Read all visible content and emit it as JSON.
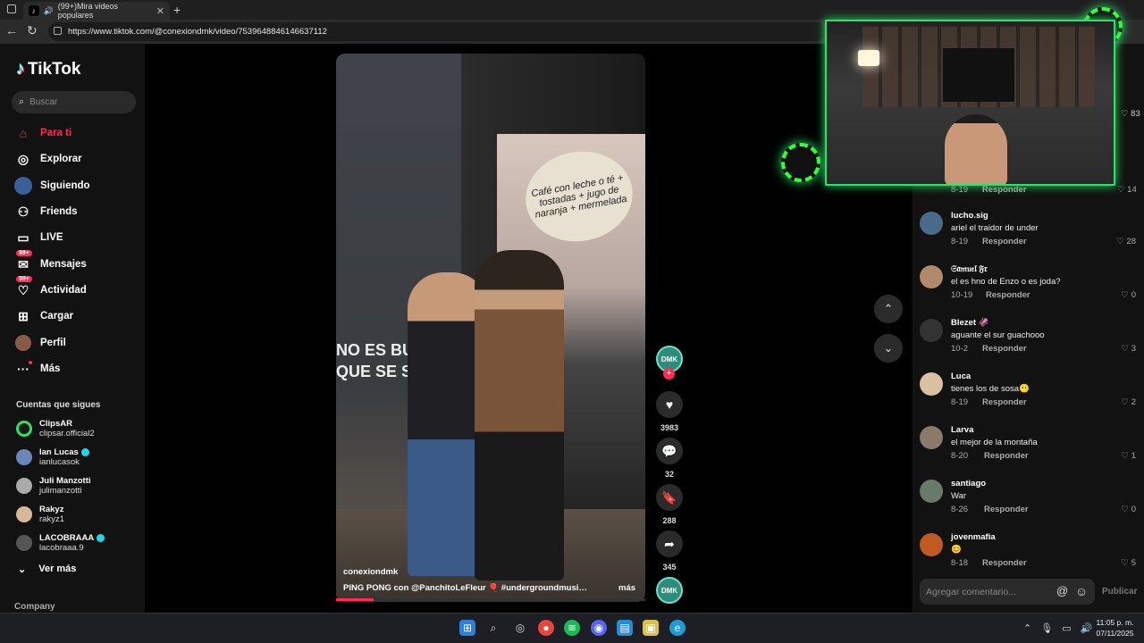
{
  "browser": {
    "tab_title": "(99+)Mira videos populares",
    "url": "https://www.tiktok.com/@conexiondmk/video/7539648846146637112"
  },
  "brand": {
    "name": "TikTok",
    "accent": "#fe2c55"
  },
  "search": {
    "placeholder": "Buscar"
  },
  "nav": [
    {
      "label": "Para ti",
      "icon": "home-icon",
      "active": true
    },
    {
      "label": "Explorar",
      "icon": "compass-icon"
    },
    {
      "label": "Siguiendo",
      "icon": "following-avatar-icon"
    },
    {
      "label": "Friends",
      "icon": "friends-icon"
    },
    {
      "label": "LIVE",
      "icon": "live-icon"
    },
    {
      "label": "Mensajes",
      "icon": "messages-icon",
      "badge": "99+"
    },
    {
      "label": "Actividad",
      "icon": "activity-icon",
      "badge": "99+"
    },
    {
      "label": "Cargar",
      "icon": "upload-icon"
    },
    {
      "label": "Perfil",
      "icon": "profile-icon"
    },
    {
      "label": "Más",
      "icon": "more-icon"
    }
  ],
  "following": {
    "title": "Cuentas que sigues",
    "accounts": [
      {
        "name": "ClipsAR",
        "handle": "clipsar.official2",
        "verified": false
      },
      {
        "name": "Ian Lucas",
        "handle": "ianlucasok",
        "verified": true
      },
      {
        "name": "Juli Manzotti",
        "handle": "julimanzotti",
        "verified": false
      },
      {
        "name": "Rakyz",
        "handle": "rakyz1",
        "verified": false
      },
      {
        "name": "LACOBRAAA",
        "handle": "lacobraaa.9",
        "verified": true
      }
    ],
    "see_more": "Ver más"
  },
  "footer_section": "Company",
  "video": {
    "sign_text": "Café con leche o té + tostadas + jugo de naranja + mermelada",
    "graffiti": "NO ES BUENO QUE SE SEP",
    "author": "conexiondmk",
    "caption": "PING PONG con @PanchitoLeFleur 🎈 #undergroundmusic ...",
    "more": "más",
    "progress": 0.12
  },
  "actions": {
    "avatar_label": "DMK",
    "likes": "3983",
    "comments": "32",
    "saves": "288",
    "shares": "345"
  },
  "comments": {
    "visible_count_partial": "83",
    "partial_row": {
      "date": "8-19",
      "reply": "Responder",
      "likes": "14"
    },
    "items": [
      {
        "user": "lucho.sig",
        "text": "ariel el traidor de under",
        "date": "8-19",
        "reply": "Responder",
        "likes": "28"
      },
      {
        "user": "𝔖𝔞𝔪𝔲𝔢𝔩 𝔉𝔯",
        "text": "el es hno de Enzo o es joda?",
        "date": "10-19",
        "reply": "Responder",
        "likes": "0"
      },
      {
        "user": "Blezet 🦑",
        "text": "aguante el sur guachooo",
        "date": "10-2",
        "reply": "Responder",
        "likes": "3"
      },
      {
        "user": "Luca",
        "text": "tienes los de sosa😶",
        "date": "8-19",
        "reply": "Responder",
        "likes": "2"
      },
      {
        "user": "Larva",
        "text": "el mejor de la montaña",
        "date": "8-20",
        "reply": "Responder",
        "likes": "1"
      },
      {
        "user": "santiago",
        "text": "War",
        "date": "8-26",
        "reply": "Responder",
        "likes": "0"
      },
      {
        "user": "jovenmafia",
        "text": "😊",
        "date": "8-18",
        "reply": "Responder",
        "likes": "5"
      }
    ],
    "input_placeholder": "Agregar comentario...",
    "publish": "Publicar"
  },
  "taskbar": {
    "time": "11:05 p. m.",
    "date": "07/11/2025"
  }
}
